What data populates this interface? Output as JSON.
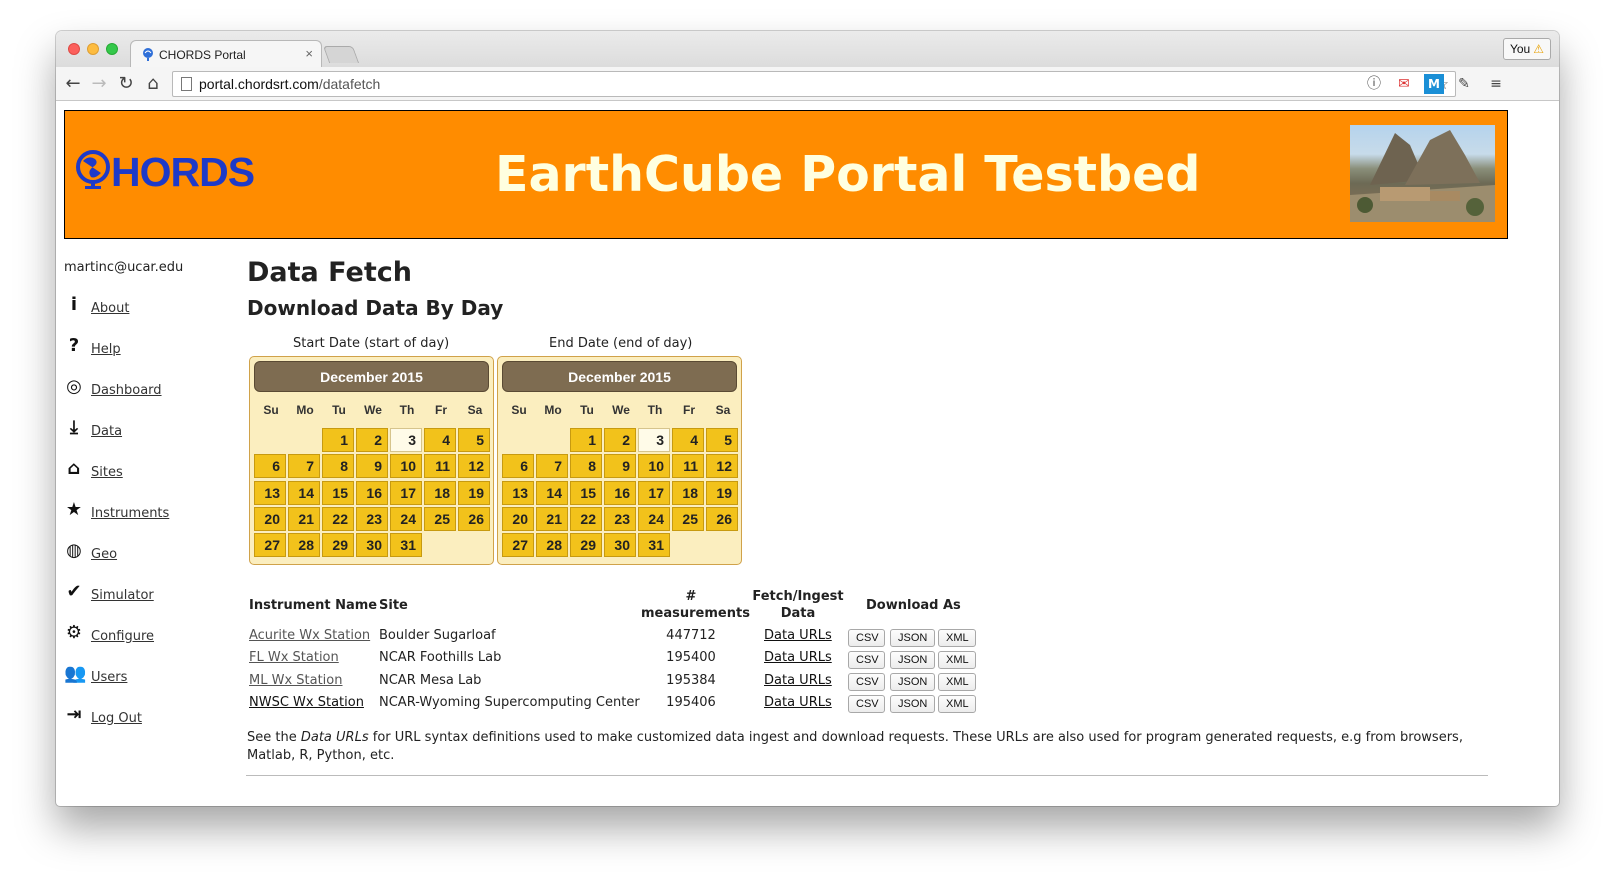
{
  "browser": {
    "tab_title": "CHORDS Portal",
    "tab_close": "×",
    "profile_label": "You",
    "url_host": "portal.chordsrt.com",
    "url_path": "/datafetch"
  },
  "banner": {
    "logo_text": "HORDS",
    "title": "EarthCube Portal Testbed"
  },
  "sidebar": {
    "user_email": "martinc@ucar.edu",
    "items": [
      {
        "label": "About",
        "icon": "info-icon",
        "glyph": "i"
      },
      {
        "label": "Help",
        "icon": "question-icon",
        "glyph": "?"
      },
      {
        "label": "Dashboard",
        "icon": "target-icon",
        "glyph": "◎"
      },
      {
        "label": "Data",
        "icon": "download-icon",
        "glyph": "⤓"
      },
      {
        "label": "Sites",
        "icon": "home-icon",
        "glyph": "⌂"
      },
      {
        "label": "Instruments",
        "icon": "star-icon",
        "glyph": "★"
      },
      {
        "label": "Geo",
        "icon": "globe-icon",
        "glyph": "◍"
      },
      {
        "label": "Simulator",
        "icon": "check-icon",
        "glyph": "✔"
      },
      {
        "label": "Configure",
        "icon": "gear-icon",
        "glyph": "⚙"
      },
      {
        "label": "Users",
        "icon": "users-icon",
        "glyph": "👥"
      },
      {
        "label": "Log Out",
        "icon": "logout-icon",
        "glyph": "⇥"
      }
    ]
  },
  "main": {
    "title": "Data Fetch",
    "subtitle": "Download Data By Day",
    "start_caption": "Start Date (start of day)",
    "end_caption": "End Date (end of day)",
    "calendar": {
      "month_label": "December 2015",
      "days_of_week": [
        "Su",
        "Mo",
        "Tu",
        "We",
        "Th",
        "Fr",
        "Sa"
      ],
      "first_weekday": 2,
      "num_days": 31,
      "today": 3
    },
    "table": {
      "headers": {
        "name": "Instrument Name",
        "site": "Site",
        "measurements_line1": "#",
        "measurements_line2": "measurements",
        "fetch_line1": "Fetch/Ingest",
        "fetch_line2": "Data",
        "download": "Download As"
      },
      "rows": [
        {
          "name": "Acurite Wx Station",
          "site": "Boulder Sugarloaf",
          "count": "447712",
          "link": "Data URLs"
        },
        {
          "name": "FL Wx Station",
          "site": "NCAR Foothills Lab",
          "count": "195400",
          "link": "Data URLs"
        },
        {
          "name": "ML Wx Station",
          "site": "NCAR Mesa Lab",
          "count": "195384",
          "link": "Data URLs"
        },
        {
          "name": "NWSC Wx Station",
          "site": "NCAR-Wyoming Supercomputing Center",
          "count": "195406",
          "link": "Data URLs"
        }
      ],
      "formats": [
        "CSV",
        "JSON",
        "XML"
      ]
    },
    "note_prefix": "See the ",
    "note_em": "Data URLs",
    "note_suffix": " for URL syntax definitions used to make customized data ingest and download requests. These URLs are also used for program generated requests, e.g from browsers, Matlab, R, Python, etc."
  }
}
